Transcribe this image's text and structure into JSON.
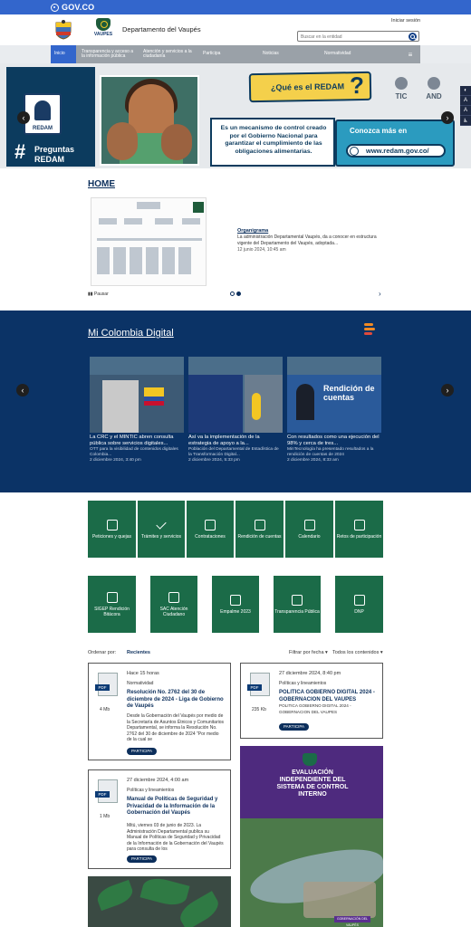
{
  "govbar": {
    "logo_text": "GOV.CO"
  },
  "header": {
    "dept_logo_label": "VAUPES",
    "dept_name": "Departamento del Vaupés",
    "login": "Iniciar sesión",
    "search_placeholder": "Buscar en la entidad"
  },
  "nav": {
    "items": [
      {
        "label": "Inicio"
      },
      {
        "label": "Transparencia y acceso a la información pública"
      },
      {
        "label": "Atención y servicios a la ciudadanía"
      },
      {
        "label": "Participa"
      },
      {
        "label": "Noticias"
      },
      {
        "label": "Normatividad"
      }
    ]
  },
  "hero": {
    "redam_label": "REDAM",
    "hash": "#",
    "hash_text_1": "Preguntas",
    "hash_text_2": "REDAM",
    "question": "¿Qué es el REDAM",
    "question_mark": "?",
    "description": "Es un mecanismo de control creado por el Gobierno Nacional para garantizar el cumplimiento de las obligaciones alimentarias.",
    "more": "Conozca más en",
    "url": "www.redam.gov.co/",
    "badge_1": "TIC",
    "badge_2": "AND"
  },
  "home": {
    "title": "HOME",
    "news_title": "Organigrama",
    "news_summary": "La administración Departamental Vaupés, da a conocer en estructura vigente del Departamento del Vaupés, adoptada...",
    "news_date": "12 junio 2024, 10:45 am",
    "pause": "Pausar",
    "next": "›"
  },
  "mcd": {
    "title": "Mi Colombia Digital",
    "cards": [
      {
        "title": "La CRC y el MINTIC abren consulta pública sobre servicios digitales...",
        "summary": "OTT para la visibilidad de contenidos digitales Colombia...",
        "date": "2 diciembre 2024, 3:40 pm"
      },
      {
        "title": "Así va la implementación de la estrategia de apoyo a la...",
        "summary": "Población del Departamental de Estadística de la Transformación Digital...",
        "date": "2 diciembre 2024, 5:33 pm"
      },
      {
        "title": "Con resultados como una ejecución del 98% y cerca de tres...",
        "summary": "MinTecnología ha presentado resultados a la rendición de cuentas de 2024",
        "date": "2 diciembre 2024, 8:33 am"
      }
    ],
    "slide_card_text": "Rendición de cuentas"
  },
  "tiles_row1": [
    {
      "label": "Peticiones y quejas"
    },
    {
      "label": "Trámites y servicios"
    },
    {
      "label": "Contrataciones"
    },
    {
      "label": "Rendición de cuentas"
    },
    {
      "label": "Calendario"
    },
    {
      "label": "Retos de participación"
    }
  ],
  "tiles_row2": [
    {
      "label": "SIGEP Rendición Bitácora"
    },
    {
      "label": "SAC Atención Ciudadano"
    },
    {
      "label": "Empalme 2023"
    },
    {
      "label": "Transparencia Pública"
    },
    {
      "label": "DNP"
    }
  ],
  "filter": {
    "order_label": "Ordenar por:",
    "order_value": "Recientes",
    "date_filter": "Filtrar por fecha ▾",
    "content_filter": "Todos los contenidos ▾"
  },
  "docs": [
    {
      "date": "Hace 15 horas",
      "category": "Normatividad",
      "title": "Resolución No. 2762 del 30 de diciembre de 2024 - Liga de Gobierno de Vaupés",
      "body": "Desde la Gobernación del Vaupés por medio de la Secretaría de Asuntos Étnicos y Comunitarios Departamental, se informa la Resolución No. 2762 del 30 de diciembre de 2024 \"Por medio de la cual se",
      "size": "4 Mb",
      "button": "PARTICIPA"
    },
    {
      "date": "27 diciembre 2024, 8:40 pm",
      "category": "Políticas y lineamientos",
      "title": "POLITICA GOBIERNO DIGITAL 2024 - GOBERNACION DEL VAUPES",
      "body": "POLITICA GOBIERNO DIGITAL 2024 - GOBERNACION DEL VAUPES",
      "size": "235 Kb",
      "button": "PARTICIPA"
    },
    {
      "date": "27 diciembre 2024, 4:00 am",
      "category": "Políticas y lineamientos",
      "title": "Manual de Políticas de Seguridad y Privacidad de la Información de la Gobernación del Vaupés",
      "body": "Mitú, viernes 03 de junio de 2023. La Administración Departamental publica su Manual de Políticas de Seguridad y Privacidad de la Información de la Gobernación del Vaupés para consulta de los",
      "size": "1 Mb",
      "button": "PARTICIPA"
    }
  ],
  "promo": {
    "title": "EVALUACIÓN INDEPENDIENTE DEL SISTEMA DE CONTROL INTERNO",
    "footer": "GOBERNACIÓN DEL VAUPÉS"
  },
  "colors": {
    "gov_blue": "#3366cc",
    "nav_gray": "#9aa1a8",
    "tile_green": "#1b6b48",
    "mcd_blue": "#0b3366",
    "promo_purple": "#4e2a7e"
  }
}
